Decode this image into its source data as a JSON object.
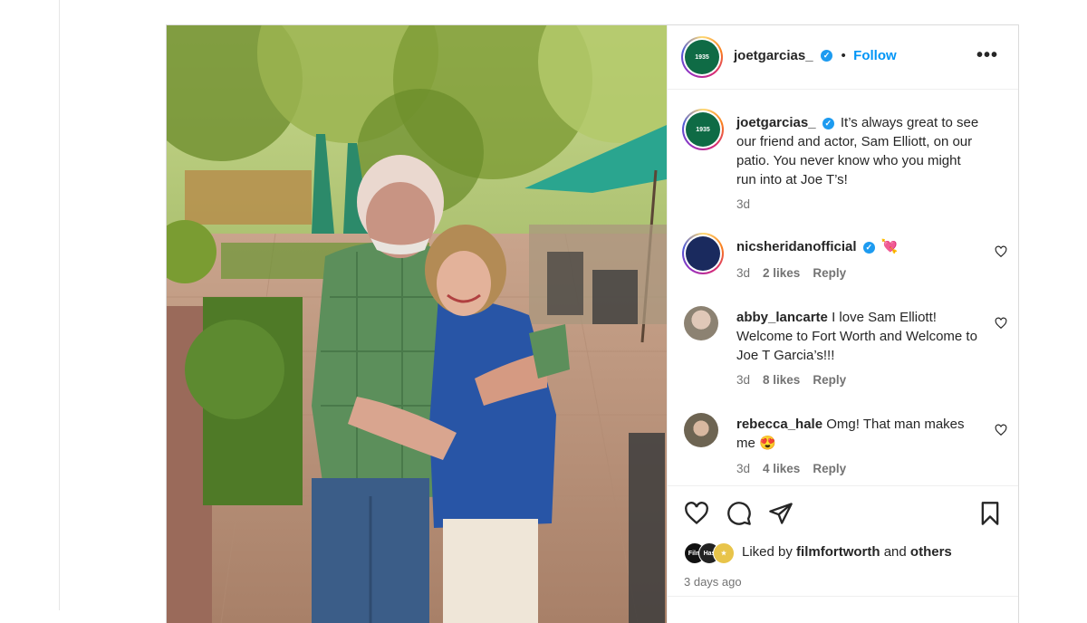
{
  "header": {
    "username": "joetgarcias_",
    "follow_label": "Follow",
    "separator": "•",
    "more_label": "•••",
    "avatar_text": "1935"
  },
  "caption": {
    "username": "joetgarcias_",
    "text": "It’s always great to see our friend and actor, Sam Elliott, on our patio. You never know who you might run into at Joe T’s!",
    "time": "3d"
  },
  "comments": [
    {
      "username": "nicsheridanofficial",
      "text": "💘",
      "time": "3d",
      "likes": "2 likes",
      "reply": "Reply"
    },
    {
      "username": "abby_lancarte",
      "text": "I love Sam Elliott! Welcome to Fort Worth and Welcome to Joe T Garcia’s!!!",
      "time": "3d",
      "likes": "8 likes",
      "reply": "Reply"
    },
    {
      "username": "rebecca_hale",
      "text": "Omg! That man makes me 😍",
      "time": "3d",
      "likes": "4 likes",
      "reply": "Reply"
    }
  ],
  "footer": {
    "liked_prefix": "Liked by",
    "liked_user": "filmfortworth",
    "liked_and": "and",
    "liked_others": "others",
    "date": "3 days ago",
    "mini_avatar_1": "Film",
    "mini_avatar_2": "Has"
  },
  "colors": {
    "link": "#0095f6",
    "verified": "#1d9bf0",
    "brand_green": "#0f6b45"
  },
  "icons": [
    "heart-icon",
    "comment-icon",
    "share-icon",
    "bookmark-icon",
    "more-icon",
    "verified-icon"
  ]
}
